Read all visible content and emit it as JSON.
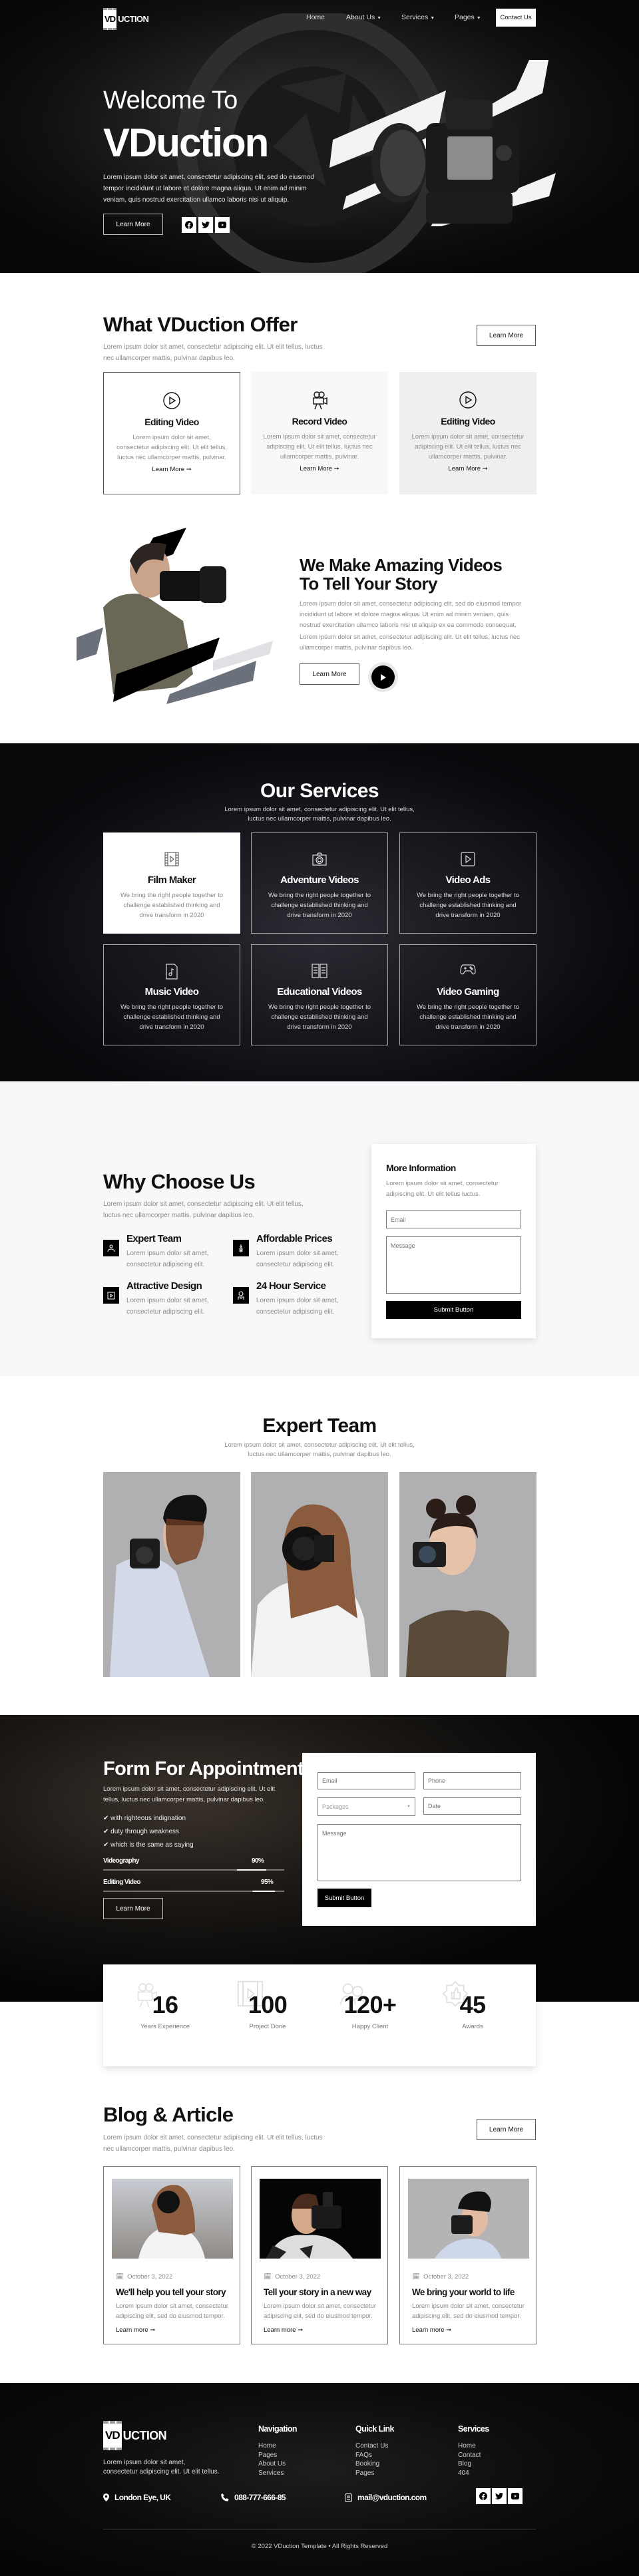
{
  "nav": {
    "logo": {
      "box": "VD",
      "rest": "UCTION"
    },
    "items": [
      {
        "label": "Home"
      },
      {
        "label": "About Us"
      },
      {
        "label": "Services"
      },
      {
        "label": "Pages"
      }
    ],
    "contact_label": "Contact Us"
  },
  "hero": {
    "subtitle": "Welcome To",
    "title": "VDuction",
    "text": "Lorem ipsum dolor sit amet, consectetur adipiscing elit, sed do eiusmod tempor incididunt ut labore et dolore magna aliqua. Ut enim ad minim veniam, quis nostrud exercitation ullamco laboris nisi ut aliquip.",
    "button": "Learn More",
    "socials": [
      "facebook-icon",
      "twitter-icon",
      "youtube-icon"
    ]
  },
  "offer": {
    "title": "What VDuction Offer",
    "text": "Lorem ipsum dolor sit amet, consectetur adipiscing elit. Ut elit tellus, luctus nec ullamcorper mattis, pulvinar dapibus leo.",
    "button": "Learn More",
    "cards": [
      {
        "icon": "play-circle-icon",
        "title": "Editing Video",
        "text": "Lorem ipsum dolor sit amet, consectetur adipiscing elit. Ut elit tellus, luctus nec ullamcorper mattis, pulvinar.",
        "link": "Learn More ➞"
      },
      {
        "icon": "movie-camera-icon",
        "title": "Record Video",
        "text": "Lorem ipsum dolor sit amet, consectetur adipiscing elit. Ut elit tellus, luctus nec ullamcorper mattis, pulvinar.",
        "link": "Learn More ➞"
      },
      {
        "icon": "play-circle-icon",
        "title": "Editing Video",
        "text": "Lorem ipsum dolor sit amet, consectetur adipiscing elit. Ut elit tellus, luctus nec ullamcorper mattis, pulvinar.",
        "link": "Learn More ➞"
      }
    ]
  },
  "about": {
    "title": "We Make Amazing Videos To Tell Your Story",
    "p1": "Lorem ipsum dolor sit amet, consectetur adipiscing elit, sed do eiusmod tempor incididunt ut labore et dolore magna aliqua. Ut enim ad minim veniam, quis nostrud exercitation ullamco laboris nisi ut aliquip ex ea commodo consequat.",
    "p2": "Lorem ipsum dolor sit amet, consectetur adipiscing elit. Ut elit tellus, luctus nec ullamcorper mattis, pulvinar dapibus leo.",
    "button": "Learn More"
  },
  "services": {
    "title": "Our Services",
    "text": "Lorem ipsum dolor sit amet, consectetur adipiscing elit. Ut elit tellus, luctus nec ullamcorper mattis, pulvinar dapibus leo.",
    "cards": [
      {
        "icon": "film-icon",
        "title": "Film Maker",
        "text": "We bring the right people together to challenge established thinking and drive transform in 2020"
      },
      {
        "icon": "camera-icon",
        "title": "Adventure Videos",
        "text": "We bring the right people together to challenge established thinking and drive transform in 2020"
      },
      {
        "icon": "play-square-icon",
        "title": "Video Ads",
        "text": "We bring the right people together to challenge established thinking and drive transform in 2020"
      },
      {
        "icon": "music-file-icon",
        "title": "Music Video",
        "text": "We bring the right people together to challenge established thinking and drive transform in 2020"
      },
      {
        "icon": "book-icon",
        "title": "Educational Videos",
        "text": "We bring the right people together to challenge established thinking and drive transform in 2020"
      },
      {
        "icon": "gamepad-icon",
        "title": "Video Gaming",
        "text": "We bring the right people together to challenge established thinking and drive transform in 2020"
      }
    ]
  },
  "why": {
    "title": "Why Choose Us",
    "text": "Lorem ipsum dolor sit amet, consectetur adipiscing elit. Ut elit tellus, luctus nec ullamcorper mattis, pulvinar dapibus leo.",
    "features": [
      {
        "title": "Expert Team",
        "text": "Lorem ipsum dolor sit amet, consectetur adipiscing elit."
      },
      {
        "title": "Affordable Prices",
        "text": "Lorem ipsum dolor sit amet, consectetur adipiscing elit."
      },
      {
        "title": "Attractive Design",
        "text": "Lorem ipsum dolor sit amet, consectetur adipiscing elit."
      },
      {
        "title": "24 Hour Service",
        "text": "Lorem ipsum dolor sit amet, consectetur adipiscing elit."
      }
    ],
    "form": {
      "title": "More Information",
      "text": "Lorem ipsum dolor sit amet, consectetur adipiscing elit. Ut elit tellus luctus.",
      "email_placeholder": "Email",
      "message_placeholder": "Message",
      "submit": "Submit Button"
    }
  },
  "team": {
    "title": "Expert Team",
    "text": "Lorem ipsum dolor sit amet, consectetur adipiscing elit. Ut elit tellus, luctus nec ullamcorper mattis, pulvinar dapibus leo."
  },
  "appointment": {
    "title": "Form For Appointment",
    "text": "Lorem ipsum dolor sit amet, consectetur adipiscing elit. Ut elit tellus, luctus nec ullamcorper mattis, pulvinar dapibus leo.",
    "checklist": [
      "with righteous indignation",
      "duty through weakness",
      "which is the same as saying"
    ],
    "skills": [
      {
        "name": "Videography",
        "value": 90,
        "label": "90%"
      },
      {
        "name": "Editing Video",
        "value": 95,
        "label": "95%"
      }
    ],
    "button": "Learn More",
    "form": {
      "email": "Email",
      "phone": "Phone",
      "packages": "Packages",
      "date": "Date",
      "message": "Message",
      "submit": "Submit Button"
    }
  },
  "stats": [
    {
      "icon": "movie-camera-icon",
      "value": "16",
      "label": "Years Experience"
    },
    {
      "icon": "film-icon",
      "value": "100",
      "label": "Project Done"
    },
    {
      "icon": "users-icon",
      "value": "120+",
      "label": "Happy Client"
    },
    {
      "icon": "award-icon",
      "value": "45",
      "label": "Awards"
    }
  ],
  "blog": {
    "title": "Blog & Article",
    "text": "Lorem ipsum dolor sit amet, consectetur adipiscing elit. Ut elit tellus, luctus nec ullamcorper mattis, pulvinar dapibus leo.",
    "button": "Learn More",
    "posts": [
      {
        "date": "October 3, 2022",
        "title": "We'll help you tell your story",
        "text": "Lorem ipsum dolor sit amet, consectetur adipiscing elit, sed do eiusmod tempor.",
        "link": "Learn more ➞"
      },
      {
        "date": "October 3, 2022",
        "title": "Tell your story in a new way",
        "text": "Lorem ipsum dolor sit amet, consectetur adipiscing elit, sed do eiusmod tempor.",
        "link": "Learn more ➞"
      },
      {
        "date": "October 3, 2022",
        "title": "We bring your world to life",
        "text": "Lorem ipsum dolor sit amet, consectetur adipiscing elit, sed do eiusmod tempor.",
        "link": "Learn more ➞"
      }
    ]
  },
  "footer": {
    "text": "Lorem ipsum dolor sit amet, consectetur adipiscing elit. Ut elit tellus.",
    "columns": [
      {
        "title": "Navigation",
        "links": [
          "Home",
          "Pages",
          "About Us",
          "Services"
        ]
      },
      {
        "title": "Quick Link",
        "links": [
          "Contact Us",
          "FAQs",
          "Booking",
          "Pages"
        ]
      },
      {
        "title": "Services",
        "links": [
          "Home",
          "Contact",
          "Blog",
          "404"
        ]
      }
    ],
    "location": "London Eye, UK",
    "phone": "088-777-666-85",
    "email": "mail@vduction.com",
    "copyright": "© 2022 VDuction Template • All Rights Reserved"
  }
}
